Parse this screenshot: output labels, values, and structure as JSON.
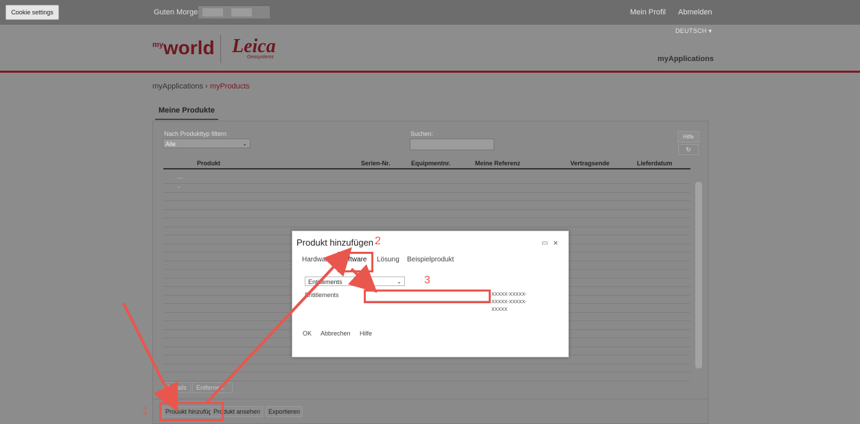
{
  "topbar": {
    "cookie_settings": "Cookie settings",
    "greeting": "Guten Morgen",
    "profile": "Mein Profil",
    "logout": "Abmelden"
  },
  "header": {
    "language": "DEUTSCH",
    "logo_myworld": "world",
    "logo_myworld_prefix": "my",
    "logo_leica": "Leica",
    "logo_leica_sub": "Geosystems",
    "section": "myApplications"
  },
  "breadcrumb": {
    "root": "myApplications",
    "separator": "›",
    "current": "myProducts"
  },
  "tab_title": "Meine Produkte",
  "filters": {
    "type_label": "Nach Produkttyp filtern",
    "type_value": "Alle",
    "search_label": "Suchen:",
    "help": "Hilfe"
  },
  "table": {
    "headers": [
      "Produkt",
      "Serien-Nr.",
      "Equipmentnr.",
      "Meine Referenz",
      "Vertragsende",
      "Lieferdatum"
    ],
    "rows": [
      "—",
      "–",
      "",
      "",
      "",
      "",
      "",
      "",
      "",
      "",
      "",
      "",
      "",
      "",
      "",
      "",
      "",
      "",
      "",
      "",
      "",
      "",
      "",
      ""
    ]
  },
  "table_actions": {
    "details": "Details",
    "remove": "Entfernen"
  },
  "bottom_actions": {
    "add": "Produkt hinzufügen",
    "view": "Produkt ansehen",
    "export": "Exportieren"
  },
  "dialog": {
    "title": "Produkt hinzufügen",
    "tabs": [
      "Hardware",
      "Software",
      "Lösung",
      "Beispielprodukt"
    ],
    "active_tab": "Software",
    "dropdown_value": "Entitlements",
    "field_label": "Entitlements",
    "field_value": "",
    "format_hint": "XXXXX-XXXXX-XXXXX-XXXXX-XXXXX",
    "buttons": [
      "OK",
      "Abbrechen",
      "Hilfe"
    ]
  },
  "annotations": {
    "step1": "1",
    "step2": "2",
    "step3": "3",
    "color": "#e9564e"
  },
  "colors": {
    "brand_red": "#7b1a24",
    "overlay_gray": "#8c8c8c"
  }
}
